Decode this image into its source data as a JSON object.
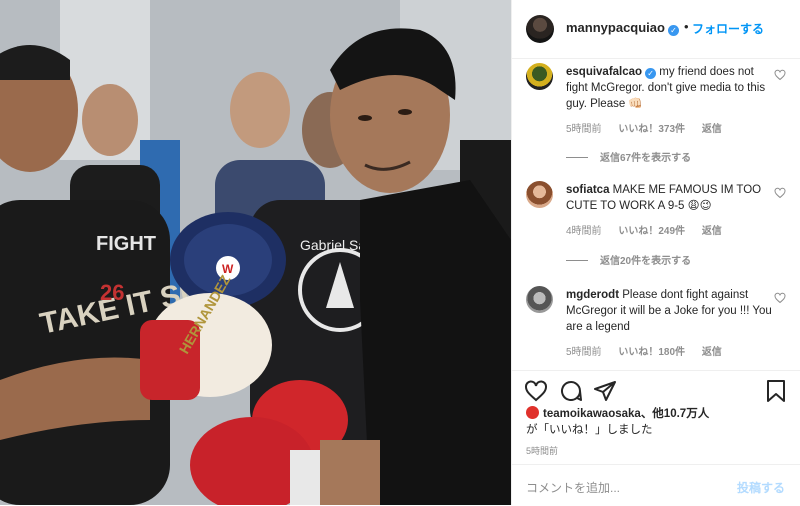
{
  "post": {
    "username": "mannypacquiao",
    "separator": "•",
    "follow_label": "フォローする"
  },
  "photo": {
    "pad_text_left": "TAKE IT SHOW",
    "pad_text_right": "HERNANDEZ",
    "shirt_left": "FIGHT",
    "shirt_left_num": "26",
    "shirt_center": "Gabriel Santos",
    "pad_brand": "W"
  },
  "comments": [
    {
      "username": "esquivafalcao",
      "verified": true,
      "text": " my friend does not fight McGregor. don't give media to this guy. Please 👊🏻",
      "time": "5時間前",
      "likes": "いいね！373件",
      "reply": "返信",
      "view_replies": "返信67件を表示する"
    },
    {
      "username": "sofiatca",
      "verified": false,
      "text": " MAKE ME FAMOUS IM TOO CUTE TO WORK A 9-5 😩😉",
      "time": "4時間前",
      "likes": "いいね！249件",
      "reply": "返信",
      "view_replies": "返信20件を表示する"
    },
    {
      "username": "mgderodt",
      "verified": false,
      "text": " Please dont fight against McGregor it will be a Joke for you !!! You are a legend",
      "time": "5時間前",
      "likes": "いいね！180件",
      "reply": "返信"
    }
  ],
  "likes_summary": {
    "liker": "teamoikawaosaka",
    "others": "、他10.7万人",
    "suffix": "が「いいね！」しました"
  },
  "posted_time": "5時間前",
  "add_comment": {
    "placeholder": "コメントを追加...",
    "post_label": "投稿する"
  },
  "icons": {
    "like": "heart-icon",
    "comment": "comment-icon",
    "share": "paper-plane-icon",
    "save": "bookmark-icon"
  }
}
